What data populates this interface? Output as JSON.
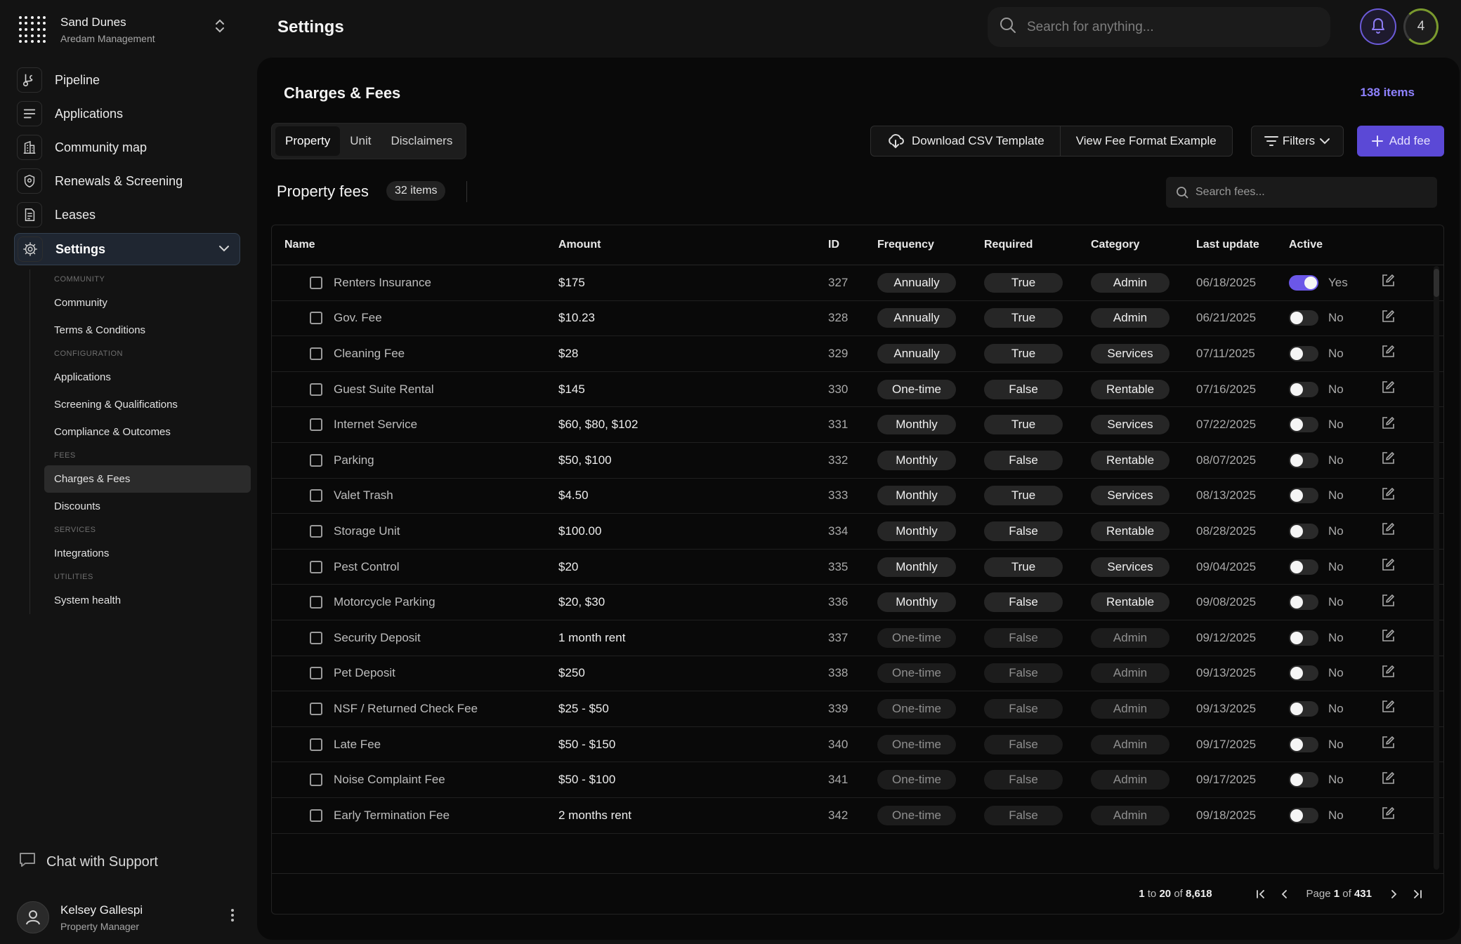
{
  "brand": {
    "name": "Sand Dunes",
    "subtitle": "Aredam Management"
  },
  "nav": {
    "items": [
      {
        "label": "Pipeline",
        "icon": "branch-icon"
      },
      {
        "label": "Applications",
        "icon": "list-icon"
      },
      {
        "label": "Community map",
        "icon": "building-icon"
      },
      {
        "label": "Renewals & Screening",
        "icon": "shield-icon"
      },
      {
        "label": "Leases",
        "icon": "document-icon"
      },
      {
        "label": "Settings",
        "icon": "gear-icon",
        "active": true
      }
    ]
  },
  "subnav": {
    "sections": [
      {
        "title": "COMMUNITY",
        "items": [
          "Community",
          "Terms & Conditions"
        ]
      },
      {
        "title": "CONFIGURATION",
        "items": [
          "Applications",
          "Screening & Qualifications",
          "Compliance & Outcomes"
        ]
      },
      {
        "title": "FEES",
        "items": [
          "Charges & Fees",
          "Discounts"
        ]
      },
      {
        "title": "SERVICES",
        "items": [
          "Integrations"
        ]
      },
      {
        "title": "UTILITIES",
        "items": [
          "System health"
        ]
      }
    ],
    "active": "Charges & Fees"
  },
  "support": {
    "label": "Chat with Support"
  },
  "user": {
    "name": "Kelsey Gallespi",
    "role": "Property Manager"
  },
  "header": {
    "title": "Settings",
    "search_placeholder": "Search for anything...",
    "counter": "4"
  },
  "panel": {
    "title": "Charges & Fees",
    "items_count": "138 items",
    "tabs": [
      "Property",
      "Unit",
      "Disclaimers"
    ],
    "active_tab": "Property",
    "download_csv": "Download CSV Template",
    "view_format": "View Fee Format Example",
    "filters": "Filters",
    "add_fee": "Add fee",
    "section_title": "Property fees",
    "section_count": "32 items",
    "fee_search_placeholder": "Search fees..."
  },
  "table": {
    "columns": [
      "Name",
      "Amount",
      "ID",
      "Frequency",
      "Required",
      "Category",
      "Last update",
      "Active"
    ],
    "rows": [
      {
        "name": "Renters Insurance",
        "amount": "$175",
        "id": "327",
        "frequency": "Annually",
        "required": "True",
        "category": "Admin",
        "updated": "06/18/2025",
        "active": true,
        "active_label": "Yes",
        "dim": false
      },
      {
        "name": "Gov. Fee",
        "amount": "$10.23",
        "id": "328",
        "frequency": "Annually",
        "required": "True",
        "category": "Admin",
        "updated": "06/21/2025",
        "active": false,
        "active_label": "No",
        "dim": false
      },
      {
        "name": "Cleaning Fee",
        "amount": "$28",
        "id": "329",
        "frequency": "Annually",
        "required": "True",
        "category": "Services",
        "updated": "07/11/2025",
        "active": false,
        "active_label": "No",
        "dim": false
      },
      {
        "name": "Guest Suite Rental",
        "amount": "$145",
        "id": "330",
        "frequency": "One-time",
        "required": "False",
        "category": "Rentable",
        "updated": "07/16/2025",
        "active": false,
        "active_label": "No",
        "dim": false
      },
      {
        "name": "Internet Service",
        "amount": "$60, $80, $102",
        "id": "331",
        "frequency": "Monthly",
        "required": "True",
        "category": "Services",
        "updated": "07/22/2025",
        "active": false,
        "active_label": "No",
        "dim": false
      },
      {
        "name": "Parking",
        "amount": "$50, $100",
        "id": "332",
        "frequency": "Monthly",
        "required": "False",
        "category": "Rentable",
        "updated": "08/07/2025",
        "active": false,
        "active_label": "No",
        "dim": false
      },
      {
        "name": "Valet Trash",
        "amount": "$4.50",
        "id": "333",
        "frequency": "Monthly",
        "required": "True",
        "category": "Services",
        "updated": "08/13/2025",
        "active": false,
        "active_label": "No",
        "dim": false
      },
      {
        "name": "Storage Unit",
        "amount": "$100.00",
        "id": "334",
        "frequency": "Monthly",
        "required": "False",
        "category": "Rentable",
        "updated": "08/28/2025",
        "active": false,
        "active_label": "No",
        "dim": false
      },
      {
        "name": "Pest Control",
        "amount": "$20",
        "id": "335",
        "frequency": "Monthly",
        "required": "True",
        "category": "Services",
        "updated": "09/04/2025",
        "active": false,
        "active_label": "No",
        "dim": false
      },
      {
        "name": "Motorcycle Parking",
        "amount": "$20, $30",
        "id": "336",
        "frequency": "Monthly",
        "required": "False",
        "category": "Rentable",
        "updated": "09/08/2025",
        "active": false,
        "active_label": "No",
        "dim": false
      },
      {
        "name": "Security Deposit",
        "amount": "1 month rent",
        "id": "337",
        "frequency": "One-time",
        "required": "False",
        "category": "Admin",
        "updated": "09/12/2025",
        "active": false,
        "active_label": "No",
        "dim": true
      },
      {
        "name": "Pet Deposit",
        "amount": "$250",
        "id": "338",
        "frequency": "One-time",
        "required": "False",
        "category": "Admin",
        "updated": "09/13/2025",
        "active": false,
        "active_label": "No",
        "dim": true
      },
      {
        "name": "NSF / Returned Check Fee",
        "amount": "$25 - $50",
        "id": "339",
        "frequency": "One-time",
        "required": "False",
        "category": "Admin",
        "updated": "09/13/2025",
        "active": false,
        "active_label": "No",
        "dim": true
      },
      {
        "name": "Late Fee",
        "amount": "$50 - $150",
        "id": "340",
        "frequency": "One-time",
        "required": "False",
        "category": "Admin",
        "updated": "09/17/2025",
        "active": false,
        "active_label": "No",
        "dim": true
      },
      {
        "name": "Noise Complaint Fee",
        "amount": "$50 - $100",
        "id": "341",
        "frequency": "One-time",
        "required": "False",
        "category": "Admin",
        "updated": "09/17/2025",
        "active": false,
        "active_label": "No",
        "dim": true
      },
      {
        "name": "Early Termination Fee",
        "amount": "2 months rent",
        "id": "342",
        "frequency": "One-time",
        "required": "False",
        "category": "Admin",
        "updated": "09/18/2025",
        "active": false,
        "active_label": "No",
        "dim": true
      }
    ]
  },
  "pagination": {
    "range_start": "1",
    "range_to": "to",
    "range_end": "20",
    "of": "of",
    "total": "8,618",
    "page_label": "Page",
    "page": "1",
    "page_of": "of",
    "pages": "431"
  },
  "colors": {
    "accent": "#5b49d6",
    "toggle_on": "#6b57e8",
    "items_count": "#8f82ff",
    "background": "#131313",
    "panel": "#090909"
  }
}
